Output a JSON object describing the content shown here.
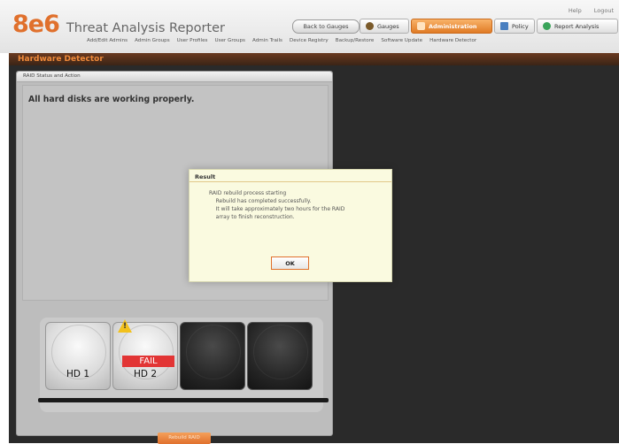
{
  "app": {
    "brand": "8e6",
    "product": "Threat Analysis Reporter"
  },
  "util_links": [
    "Help",
    "Logout"
  ],
  "back_button": "Back to Gauges",
  "tabs": [
    {
      "label": "Gauges",
      "icon": "gauge-icon",
      "active": false
    },
    {
      "label": "Administration",
      "icon": "admin-icon",
      "active": true
    },
    {
      "label": "Policy",
      "icon": "policy-icon",
      "active": false
    },
    {
      "label": "Report Analysis",
      "icon": "report-icon",
      "active": false
    }
  ],
  "subnav": [
    "Add/Edit Admins",
    "Admin Groups",
    "User Profiles",
    "User Groups",
    "Admin Trails",
    "Device Registry",
    "Backup/Restore",
    "Software Update",
    "Hardware Detector"
  ],
  "page_title": "Hardware Detector",
  "panel": {
    "title": "RAID Status and Action",
    "status_message": "All hard disks are working properly."
  },
  "disks": [
    {
      "label": "HD 1",
      "state": "ok",
      "badge": ""
    },
    {
      "label": "HD 2",
      "state": "ok",
      "badge": "FAIL"
    },
    {
      "label": "",
      "state": "empty",
      "badge": ""
    },
    {
      "label": "",
      "state": "empty",
      "badge": ""
    }
  ],
  "rebuild_button": "Rebuild RAID",
  "modal": {
    "title": "Result",
    "lines": [
      "RAID rebuild process starting",
      "",
      "    Rebuild has completed successfully.",
      "    It will take approximately two hours for the RAID",
      "    array to finish reconstruction."
    ],
    "ok_label": "OK"
  },
  "colors": {
    "accent": "#e0702c",
    "fail": "#e23535",
    "warning": "#f2c11c"
  }
}
